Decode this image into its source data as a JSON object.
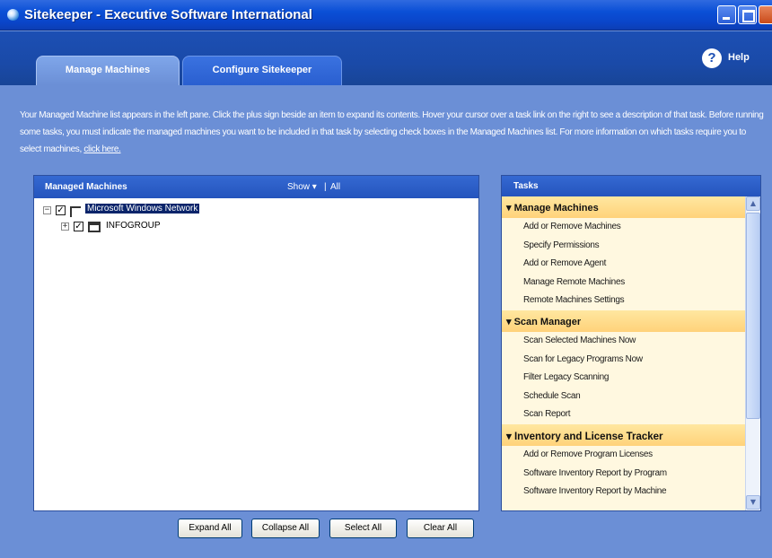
{
  "window": {
    "title": "Sitekeeper - Executive Software International"
  },
  "tabs": [
    {
      "label": "Manage Machines",
      "active": true
    },
    {
      "label": "Configure Sitekeeper",
      "active": false
    }
  ],
  "help": {
    "label": "Help"
  },
  "description": {
    "text": "Your Managed Machine list appears in the left pane. Click the plus sign beside an item to expand its contents. Hover your cursor over a task link on the right to see a description of that task. Before running some tasks, you must indicate the managed machines you want to be included in that task by selecting check boxes in the Managed Machines list. For more information on which tasks require you to select machines,",
    "link": "click here."
  },
  "managed_machines": {
    "title": "Managed Machines",
    "show_label": "Show ▾",
    "separator": "|",
    "all_label": "All",
    "tree": [
      {
        "label": "Microsoft Windows Network",
        "checked": true,
        "expander": "−",
        "selected": true
      },
      {
        "label": "INFOGROUP",
        "checked": true,
        "expander": "+",
        "selected": false
      }
    ]
  },
  "buttons": {
    "expand_all": "Expand All",
    "collapse_all": "Collapse All",
    "select_all": "Select All",
    "clear_all": "Clear All"
  },
  "tasks": {
    "title": "Tasks",
    "sections": [
      {
        "title": "▾ Manage Machines",
        "items": [
          "Add or Remove Machines",
          "Specify Permissions",
          "Add or Remove Agent",
          "Manage Remote Machines",
          "Remote Machines Settings"
        ]
      },
      {
        "title": "▾ Scan Manager",
        "items": [
          "Scan Selected Machines Now",
          "Scan for Legacy Programs Now",
          "Filter Legacy Scanning",
          "Schedule Scan",
          "Scan Report"
        ]
      },
      {
        "title": "▾ Inventory and License Tracker",
        "items": [
          "Add or Remove Program Licenses",
          "Software Inventory Report by Program",
          "Software Inventory Report by Machine"
        ]
      }
    ]
  },
  "colors": {
    "title_bar": "#0a45c9",
    "window_bg": "#6b8fd6",
    "panel_header": "#2454bd",
    "tasks_bg": "#fff8e0",
    "section_header": "#ffd27a",
    "selection": "#0a246a"
  },
  "icons": {
    "app": "sitekeeper-app-icon",
    "help": "help-icon",
    "network": "network-icon",
    "workgroup": "workgroup-icon"
  }
}
